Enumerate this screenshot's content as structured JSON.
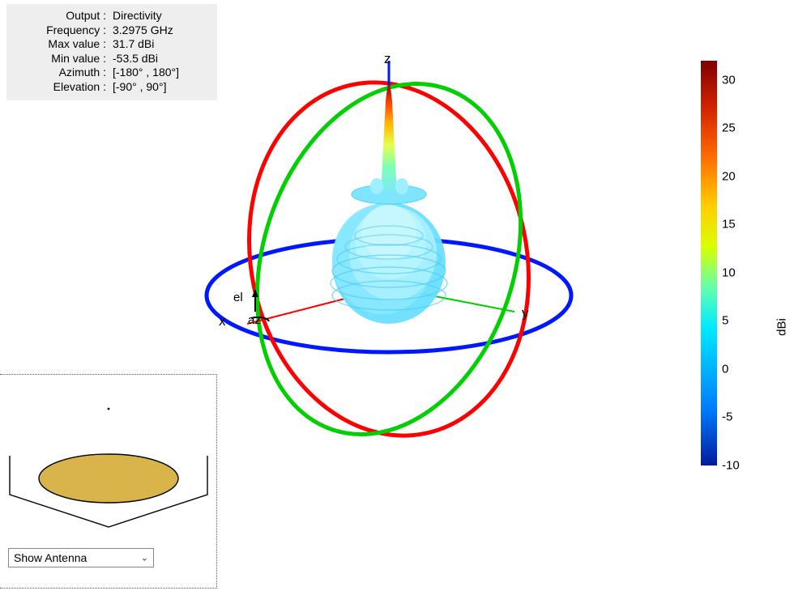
{
  "info": {
    "labels": {
      "output": "Output",
      "frequency": "Frequency",
      "max": "Max value",
      "min": "Min value",
      "azimuth": "Azimuth",
      "elevation": "Elevation"
    },
    "sep": ":",
    "values": {
      "output": "Directivity",
      "frequency": "3.2975 GHz",
      "max": "31.7 dBi",
      "min": "-53.5 dBi",
      "azimuth": "[-180° , 180°]",
      "elevation": "[-90° , 90°]"
    }
  },
  "axes": {
    "x": "x",
    "y": "y",
    "z": "z",
    "az": "az",
    "el": "el"
  },
  "antenna_select": {
    "value": "Show Antenna"
  },
  "colorbar": {
    "unit": "dBi",
    "ticks": [
      30,
      25,
      20,
      15,
      10,
      5,
      0,
      -5,
      -10
    ],
    "min": -10,
    "max": 32
  },
  "chart_data": {
    "type": "other",
    "description": "3D antenna radiation pattern (directivity, dBi) with three orthogonal coordinate rings (red/green/blue) and a central radiation lobe peaking along +z.",
    "coordinate_rings": [
      {
        "plane": "xy",
        "color": "#0018ff"
      },
      {
        "plane": "xz",
        "color": "#ff0000"
      },
      {
        "plane": "yz",
        "color": "#00cf00"
      }
    ],
    "axis_arrows": [
      {
        "name": "x",
        "color": "#ff0000"
      },
      {
        "name": "y",
        "color": "#00cf00"
      },
      {
        "name": "z",
        "color": "#0018ff"
      },
      {
        "name": "az",
        "color": "#000000"
      },
      {
        "name": "el",
        "color": "#000000"
      }
    ],
    "pattern": {
      "main_lobe_direction": "+z",
      "max_dBi": 31.7,
      "min_dBi": -53.5,
      "body_dBi_approx": 5,
      "color_scale_unit": "dBi",
      "color_scale_range": [
        -10,
        32
      ]
    },
    "frequency_GHz": 3.2975,
    "azimuth_range_deg": [
      -180,
      180
    ],
    "elevation_range_deg": [
      -90,
      90
    ]
  }
}
